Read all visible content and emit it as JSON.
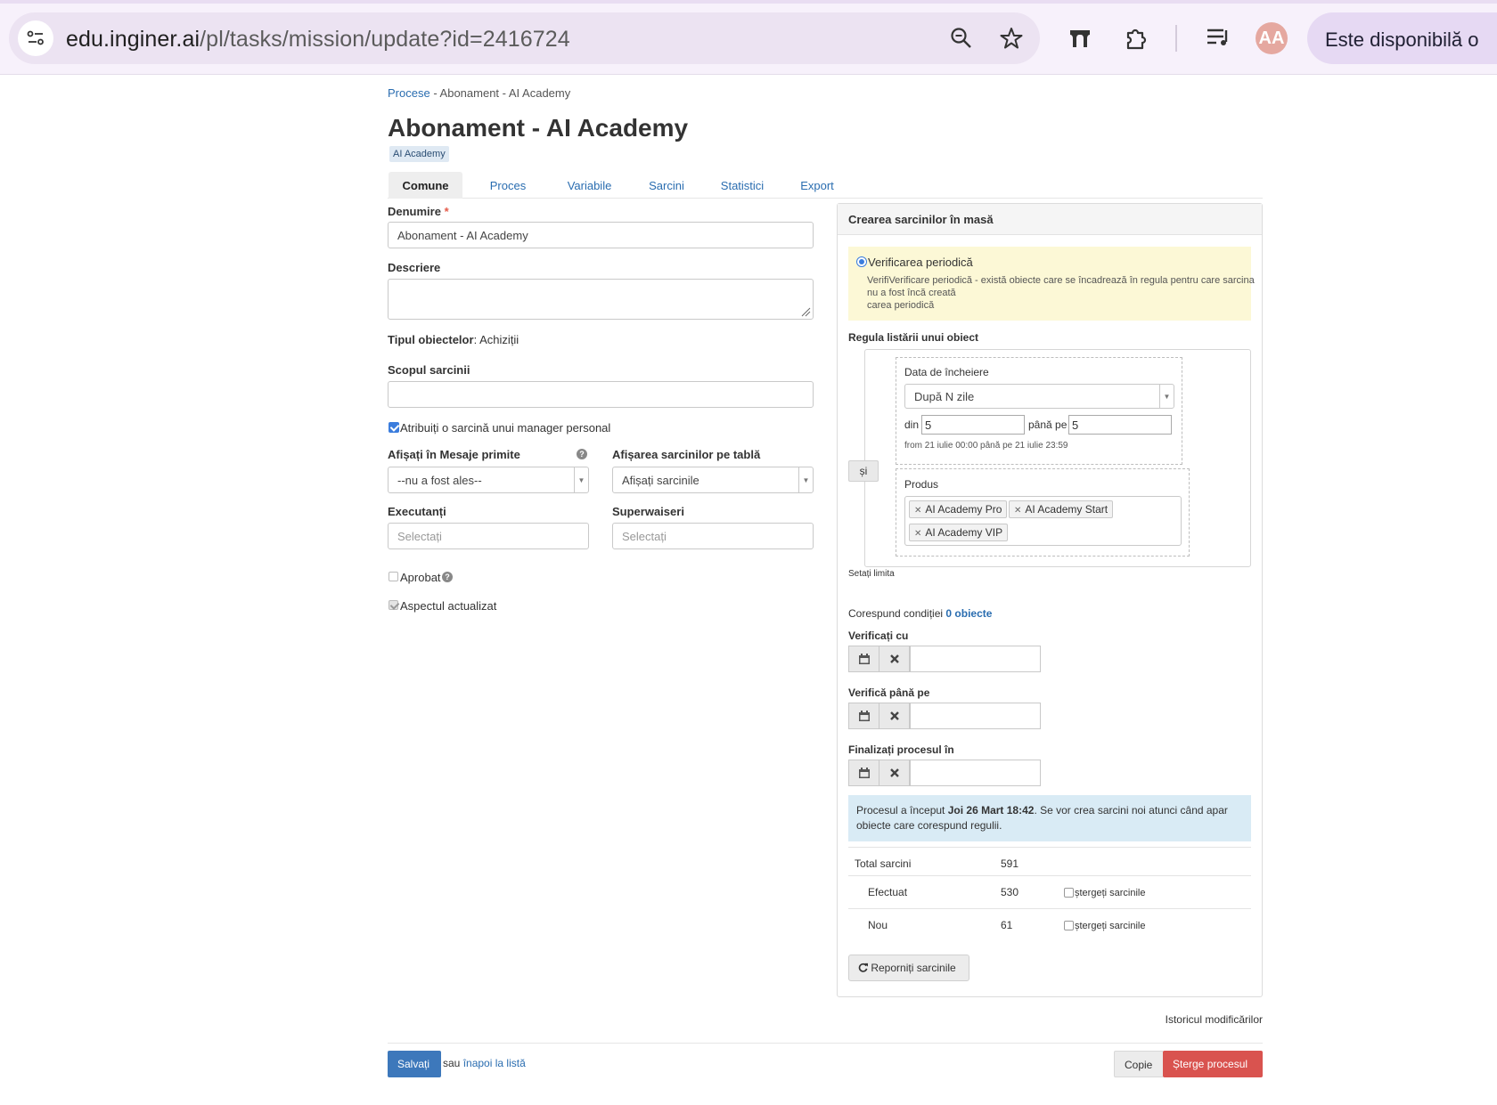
{
  "browser": {
    "url_host": "edu.inginer.ai",
    "url_path": "/pl/tasks/mission/update?id=2416724",
    "promo_text": "Este disponibilă o",
    "avatar_text": "AA"
  },
  "breadcrumb": {
    "link": "Procese",
    "separator": " - ",
    "current": "Abonament - AI Academy"
  },
  "page_title": "Abonament - AI Academy",
  "tag": "AI Academy",
  "tabs": [
    {
      "label": "Comune",
      "active": true
    },
    {
      "label": "Proces"
    },
    {
      "label": "Variabile"
    },
    {
      "label": "Sarcini"
    },
    {
      "label": "Statistici"
    },
    {
      "label": "Export"
    }
  ],
  "form": {
    "name_label": "Denumire",
    "required_mark": "*",
    "name_value": "Abonament - AI Academy",
    "description_label": "Descriere",
    "object_type_label": "Tipul obiectelor",
    "object_type_value": ": Achiziții",
    "goal_label": "Scopul sarcinii",
    "assign_manager_label": "Atribuiți o sarcină unui manager personal",
    "show_inbox_label": "Afișați în Mesaje primite",
    "show_inbox_value": "--nu a fost ales--",
    "board_label": "Afișarea sarcinilor pe tablă",
    "board_value": "Afișați sarcinile",
    "executors_label": "Executanți",
    "executors_placeholder": "Selectați",
    "supervisors_label": "Superwaiseri",
    "supervisors_placeholder": "Selectați",
    "approved_label": "Aprobat",
    "updated_label": "Aspectul actualizat"
  },
  "panel": {
    "title": "Crearea sarcinilor în masă",
    "periodic_label": "Verificarea periodică",
    "periodic_desc_1": "VerifiVerificare periodică - există obiecte care se încadrează în regula pentru care sarcina",
    "periodic_desc_2": "nu a fost încă creată",
    "periodic_desc_3": "carea periodică",
    "rule_label": "Regula listării unui obiect",
    "and_label": "și",
    "end_date_label": "Data de încheiere",
    "end_date_mode": "După N zile",
    "from_label": "din",
    "from_value": "5",
    "to_label": "până pe",
    "to_value": "5",
    "range_hint": "from 21 iulie 00:00 până pe 21 iulie 23:59",
    "product_label": "Produs",
    "products": [
      "AI Academy Pro",
      "AI Academy Start",
      "AI Academy VIP"
    ],
    "set_limit": "Setați limita",
    "match_text": "Corespund condiției",
    "match_link": "0 obiecte",
    "check_from_label": "Verificați cu",
    "check_until_label": "Verifică până pe",
    "finish_label": "Finalizați procesul în",
    "info_prefix": "Procesul a început ",
    "info_bold": "Joi 26 Mart 18:42",
    "info_suffix": ". Se vor crea sarcini noi atunci când apar obiecte care corespund regulii.",
    "stats": {
      "total_label": "Total sarcini",
      "total_value": "591",
      "done_label": "Efectuat",
      "done_value": "530",
      "new_label": "Nou",
      "new_value": "61",
      "delete_label": "ștergeți sarcinile"
    },
    "restart_label": "Reporniți sarcinile"
  },
  "history_link": "Istoricul modificărilor",
  "footer": {
    "save": "Salvați",
    "or": "sau",
    "back": "înapoi la listă",
    "copy": "Copie",
    "delete": "Șterge procesul"
  },
  "colors": {
    "link": "#2a6db0",
    "primary": "#3d78bb",
    "danger": "#d9534f",
    "warning_bg": "#fcf8d6",
    "info_bg": "#d9ebf5"
  }
}
